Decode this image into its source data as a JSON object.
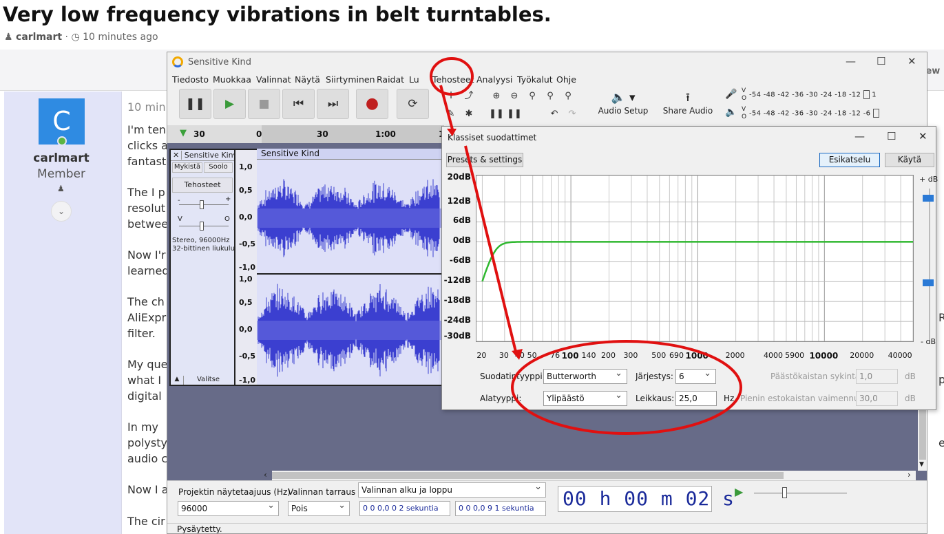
{
  "forum": {
    "title": "Very low frequency vibrations in belt turntables.",
    "author": "carlmart",
    "time_ago": "10 minutes ago",
    "post_time_partial": "10 min",
    "user_initial": "C",
    "user_role": "Member",
    "right_fragment_view": "iew",
    "lines": [
      "I'm ten",
      "clicks a",
      "fantast",
      "The I p",
      "resolut",
      "betwee",
      "Now I'r",
      "learned",
      "The ch",
      "AliExpr",
      "filter.",
      "My que",
      "what I",
      "digital",
      "In my",
      "polysty",
      "audio c",
      "Now I a",
      "The cir"
    ],
    "right_fragments": [
      "ect",
      "R",
      "p"
    ]
  },
  "app": {
    "title": "Sensitive Kind",
    "menu": [
      "Tiedosto",
      "Muokkaa",
      "Valinnat",
      "Näytä",
      "Siirtyminen",
      "Raidat",
      "Lu",
      "Tehosteet",
      "Analyysi",
      "Työkalut",
      "Ohje"
    ],
    "audio_setup_label": "Audio Setup",
    "share_audio_label": "Share Audio",
    "meter_scale": "-54 -48 -42 -36 -30 -24 -18 -12",
    "meter_end_top": "1",
    "meter_end_bottom": "-6",
    "timeline_labels": [
      "30",
      "0",
      "30",
      "1:00",
      "1"
    ],
    "track": {
      "name": "Sensitive Kin",
      "mute": "Mykistä",
      "solo": "Soolo",
      "effects": "Tehosteet",
      "gain_left": "-",
      "gain_right": "+",
      "pan_left": "V",
      "pan_right": "O",
      "info_line1": "Stereo, 96000Hz",
      "info_line2": "32-bittinen liukuluku",
      "select": "Valitse",
      "clip_name": "Sensitive Kind"
    },
    "scale_labels": [
      "1,0",
      "0,5",
      "0,0",
      "-0,5",
      "-1,0",
      "1,0",
      "0,5",
      "0,0",
      "-0,5",
      "-1,0"
    ],
    "bottom": {
      "rate_label": "Projektin näytetaajuus (Hz)",
      "rate_value": "96000",
      "snap_label": "Valinnan tarraus",
      "snap_value": "Pois",
      "selection_mode": "Valinnan alku ja loppu",
      "sel_start": "0 0 0,0 0 2 sekuntia",
      "sel_end": "0 0 0,0 9 1 sekuntia",
      "big_time": "00 h 00 m 02 s"
    },
    "status": "Pysäytetty."
  },
  "dialog": {
    "title": "Klassiset suodattimet",
    "presets_button": "Presets & settings",
    "preview_button": "Esikatselu",
    "apply_button": "Käytä",
    "y_labels": [
      "20dB",
      "12dB",
      "6dB",
      "0dB",
      "-6dB",
      "-12dB",
      "-18dB",
      "-24dB",
      "-30dB"
    ],
    "x_labels": [
      "20",
      "30",
      "40",
      "50",
      "76",
      "100",
      "140",
      "200",
      "300",
      "500",
      "690",
      "1000",
      "2000",
      "4000",
      "5900",
      "10000",
      "20000",
      "40000"
    ],
    "plus_db": "+ dB",
    "minus_db": "- dB",
    "filter_type_label": "Suodatintyyppi:",
    "filter_type_value": "Butterworth",
    "order_label": "Järjestys:",
    "order_value": "6",
    "passband_label": "Päästökaistan sykintä:",
    "passband_value": "1,0",
    "passband_unit": "dB",
    "subtype_label": "Alatyyppi:",
    "subtype_value": "Ylipäästö",
    "cutoff_label": "Leikkaus:",
    "cutoff_value": "25,0",
    "cutoff_unit": "Hz",
    "stopband_label": "Pienin estokaistan vaimennus:",
    "stopband_value": "30,0",
    "stopband_unit": "dB"
  },
  "colors": {
    "accent_red": "#e01010",
    "waveform": "#3b3fd0",
    "curve": "#2fb82f",
    "avatar": "#2f8be2"
  }
}
